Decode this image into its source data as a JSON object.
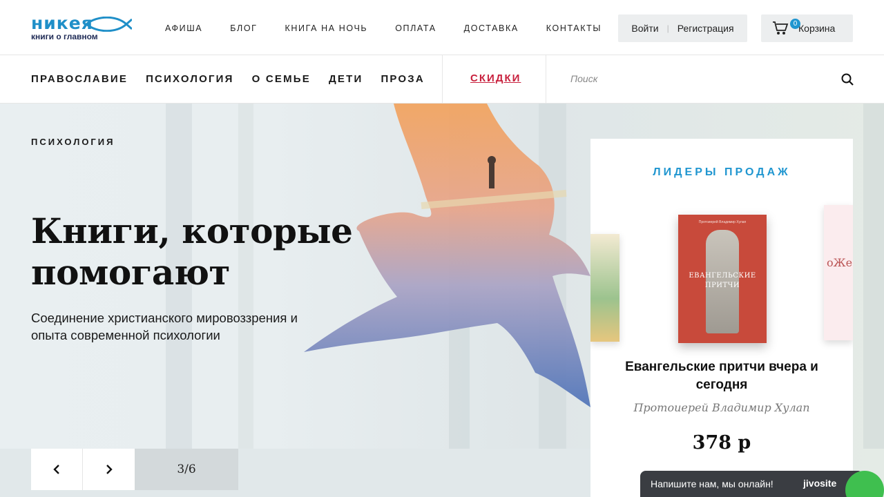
{
  "header": {
    "logo_text": "никея",
    "logo_tagline": "книги о главном",
    "nav": [
      "АФИША",
      "БЛОГ",
      "КНИГА НА НОЧЬ",
      "ОПЛАТА",
      "ДОСТАВКА",
      "КОНТАКТЫ"
    ],
    "login_label": "Войти",
    "register_label": "Регистрация",
    "cart_label": "Корзина",
    "cart_count": "0"
  },
  "categories": {
    "items": [
      "ПРАВОСЛАВИЕ",
      "ПСИХОЛОГИЯ",
      "О СЕМЬЕ",
      "ДЕТИ",
      "ПРОЗА"
    ],
    "sale_label": "СКИДКИ",
    "search_placeholder": "Поиск"
  },
  "hero": {
    "eyebrow": "ПСИХОЛОГИЯ",
    "title": "Книги, которые помогают",
    "subtitle": "Соединение христианского мировоззрения и опыта современной психологии",
    "slide_counter": "3/6"
  },
  "bestsellers": {
    "heading": "ЛИДЕРЫ ПРОДАЖ",
    "book_cover_author": "Протоиерей Владимир Хулап",
    "book_cover_title": "ЕВАНГЕЛЬСКИЕ ПРИТЧИ",
    "book_title": "Евангельские притчи вчера и сегодня",
    "book_author": "Протоиерей Владимир Хулап",
    "book_price": "378 р",
    "next_book_fragment": "оЖе"
  },
  "chat": {
    "message": "Напишите нам, мы онлайн!",
    "brand": "jivosite"
  },
  "colors": {
    "brand_blue": "#2096d0",
    "sale_red": "#c8203d",
    "book_red": "#c84a3b",
    "chat_bg": "#3a3d42",
    "chat_green": "#3fbf4f"
  }
}
